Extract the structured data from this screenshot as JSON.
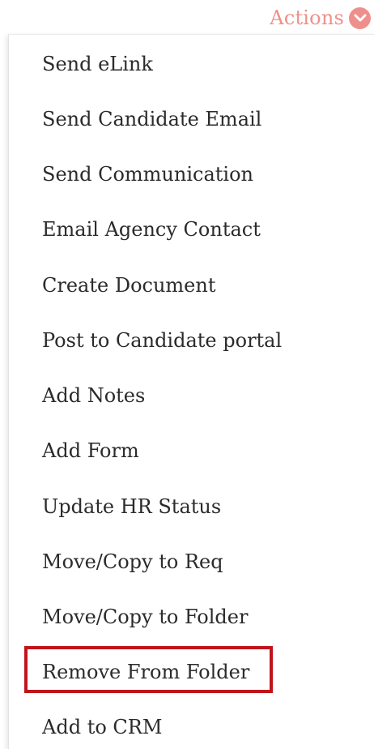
{
  "header": {
    "actions_label": "Actions",
    "actions_icon": "chevron-down-icon",
    "accent_color": "#ef8f8b"
  },
  "menu": {
    "items": [
      {
        "label": "Send eLink"
      },
      {
        "label": "Send Candidate Email"
      },
      {
        "label": "Send Communication"
      },
      {
        "label": "Email Agency Contact"
      },
      {
        "label": "Create Document"
      },
      {
        "label": "Post to Candidate portal"
      },
      {
        "label": "Add Notes"
      },
      {
        "label": "Add Form"
      },
      {
        "label": "Update HR Status"
      },
      {
        "label": "Move/Copy to Req"
      },
      {
        "label": "Move/Copy to Folder"
      },
      {
        "label": "Remove From Folder"
      },
      {
        "label": "Add to CRM"
      }
    ],
    "highlighted_item": "Remove From Folder",
    "highlight_color": "#c0141c"
  }
}
